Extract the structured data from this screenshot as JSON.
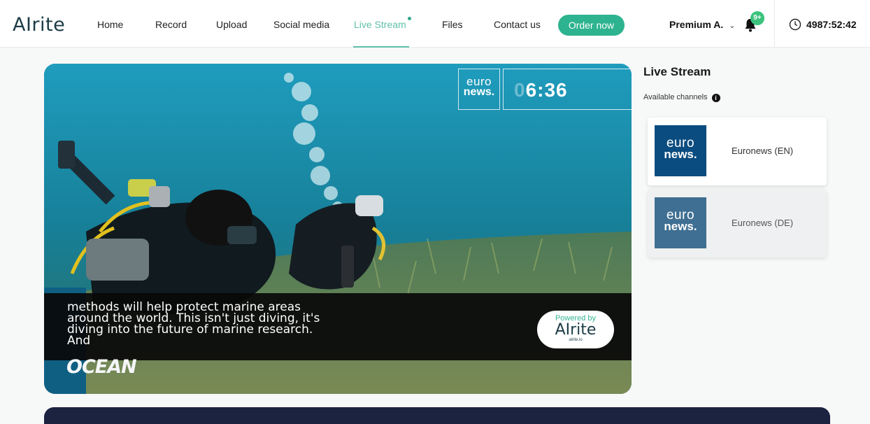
{
  "brand": {
    "logo_text": "AIrite"
  },
  "nav": {
    "links": [
      "Home",
      "Record",
      "Upload",
      "Social media",
      "Live Stream",
      "Files",
      "Contact us"
    ],
    "active": "Live Stream",
    "order_button": "Order now",
    "account": "Premium A.",
    "notification_badge": "9+",
    "timer": "4987:52:42"
  },
  "player": {
    "channel_logo": {
      "line1": "euro",
      "line2": "news."
    },
    "clock_faded": "0",
    "clock": "6:36",
    "caption_lines": [
      "methods will help protect marine areas",
      "around the world. This isn't just diving, it's",
      "diving into the future of marine research.",
      "And"
    ],
    "powered_by": {
      "label": "Powered by",
      "logo": "AIrite",
      "url": "airite.io"
    },
    "overlay_text": "OCEAN"
  },
  "side": {
    "title": "Live Stream",
    "channels_label": "Available channels",
    "channels": [
      {
        "name": "Euronews (EN)",
        "thumb_line1": "euro",
        "thumb_line2": "news."
      },
      {
        "name": "Euronews (DE)",
        "thumb_line1": "euro",
        "thumb_line2": "news."
      }
    ]
  },
  "colors": {
    "accent": "#2db38f",
    "brand_dark": "#1c3c46",
    "water": "#1a8fae",
    "channel_en": "#0a4c7f",
    "channel_de": "#3f6f92",
    "bottom_panel": "#1c2341"
  }
}
